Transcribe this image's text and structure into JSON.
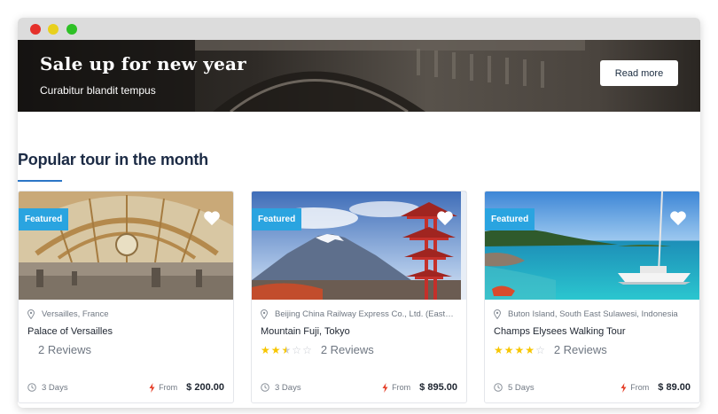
{
  "window": {
    "controls": [
      "close",
      "minimize",
      "maximize"
    ]
  },
  "banner": {
    "title": "Sale up for new year",
    "subtitle": "Curabitur blandit tempus",
    "button_label": "Read more"
  },
  "section": {
    "title": "Popular tour in the month"
  },
  "tours": [
    {
      "badge": "Featured",
      "location": "Versailles, France",
      "name": "Palace of Versailles",
      "stars_filled": 0,
      "reviews": "2 Reviews",
      "duration": "3 Days",
      "from_label": "From",
      "price": "$ 200.00"
    },
    {
      "badge": "Featured",
      "location": "Beijing China Railway Express Co., Ltd. (Easte...",
      "name": "Mountain Fuji, Tokyo",
      "stars_filled": 2.5,
      "reviews": "2 Reviews",
      "duration": "3 Days",
      "from_label": "From",
      "price": "$ 895.00"
    },
    {
      "badge": "Featured",
      "location": "Buton Island, South East Sulawesi, Indonesia",
      "name": "Champs Elysees Walking Tour",
      "stars_filled": 4,
      "reviews": "2 Reviews",
      "duration": "5 Days",
      "from_label": "From",
      "price": "$ 89.00"
    }
  ],
  "colors": {
    "accent_blue": "#2aa4e0",
    "title_navy": "#1c2b45",
    "star_yellow": "#f7c600",
    "bolt_red": "#e5402a"
  }
}
